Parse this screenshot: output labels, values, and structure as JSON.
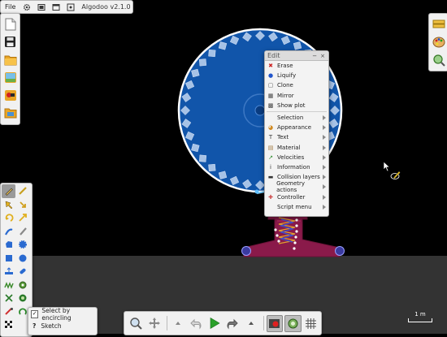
{
  "app": {
    "file_label": "File",
    "title": "Algodoo v2.1.0"
  },
  "options": {
    "select_by_encircling": "Select by encircling",
    "select_by_encircling_checked": true,
    "sketch": "Sketch"
  },
  "scale": {
    "label": "1 m"
  },
  "edit_menu": {
    "title": "Edit",
    "minimize": "−",
    "close": "×",
    "actions": [
      {
        "label": "Erase",
        "icon": "erase-icon",
        "glyph": "✖",
        "color": "#cc2222"
      },
      {
        "label": "Liquify",
        "icon": "liquify-icon",
        "glyph": "●",
        "color": "#2255cc"
      },
      {
        "label": "Clone",
        "icon": "clone-icon",
        "glyph": "▢",
        "color": "#555555"
      },
      {
        "label": "Mirror",
        "icon": "mirror-icon",
        "glyph": "▦",
        "color": "#444444"
      },
      {
        "label": "Show plot",
        "icon": "plot-icon",
        "glyph": "▩",
        "color": "#444444"
      }
    ],
    "submenus": [
      {
        "label": "Selection",
        "icon": "selection-icon",
        "glyph": "",
        "color": "#444444"
      },
      {
        "label": "Appearance",
        "icon": "palette-icon",
        "glyph": "◕",
        "color": "#d08a22"
      },
      {
        "label": "Text",
        "icon": "text-icon",
        "glyph": "T",
        "color": "#333333"
      },
      {
        "label": "Material",
        "icon": "material-icon",
        "glyph": "▤",
        "color": "#a07840"
      },
      {
        "label": "Velocities",
        "icon": "velocities-icon",
        "glyph": "↗",
        "color": "#2a8a2a"
      },
      {
        "label": "Information",
        "icon": "information-icon",
        "glyph": "i",
        "color": "#333333"
      },
      {
        "label": "Collision layers",
        "icon": "collision-layers-icon",
        "glyph": "▬",
        "color": "#333333"
      },
      {
        "label": "Geometry actions",
        "icon": "geometry-actions-icon",
        "glyph": "",
        "color": "#444444"
      },
      {
        "label": "Controller",
        "icon": "controller-icon",
        "glyph": "✚",
        "color": "#cc4444"
      },
      {
        "label": "Script menu",
        "icon": "script-icon",
        "glyph": "",
        "color": "#444444"
      }
    ]
  },
  "colors": {
    "background": "#000000",
    "ground": "#333333",
    "wheel": "#1155aa",
    "stand": "#8a1a4a",
    "panel": "#f1f1f1",
    "play": "#2aa02a"
  }
}
